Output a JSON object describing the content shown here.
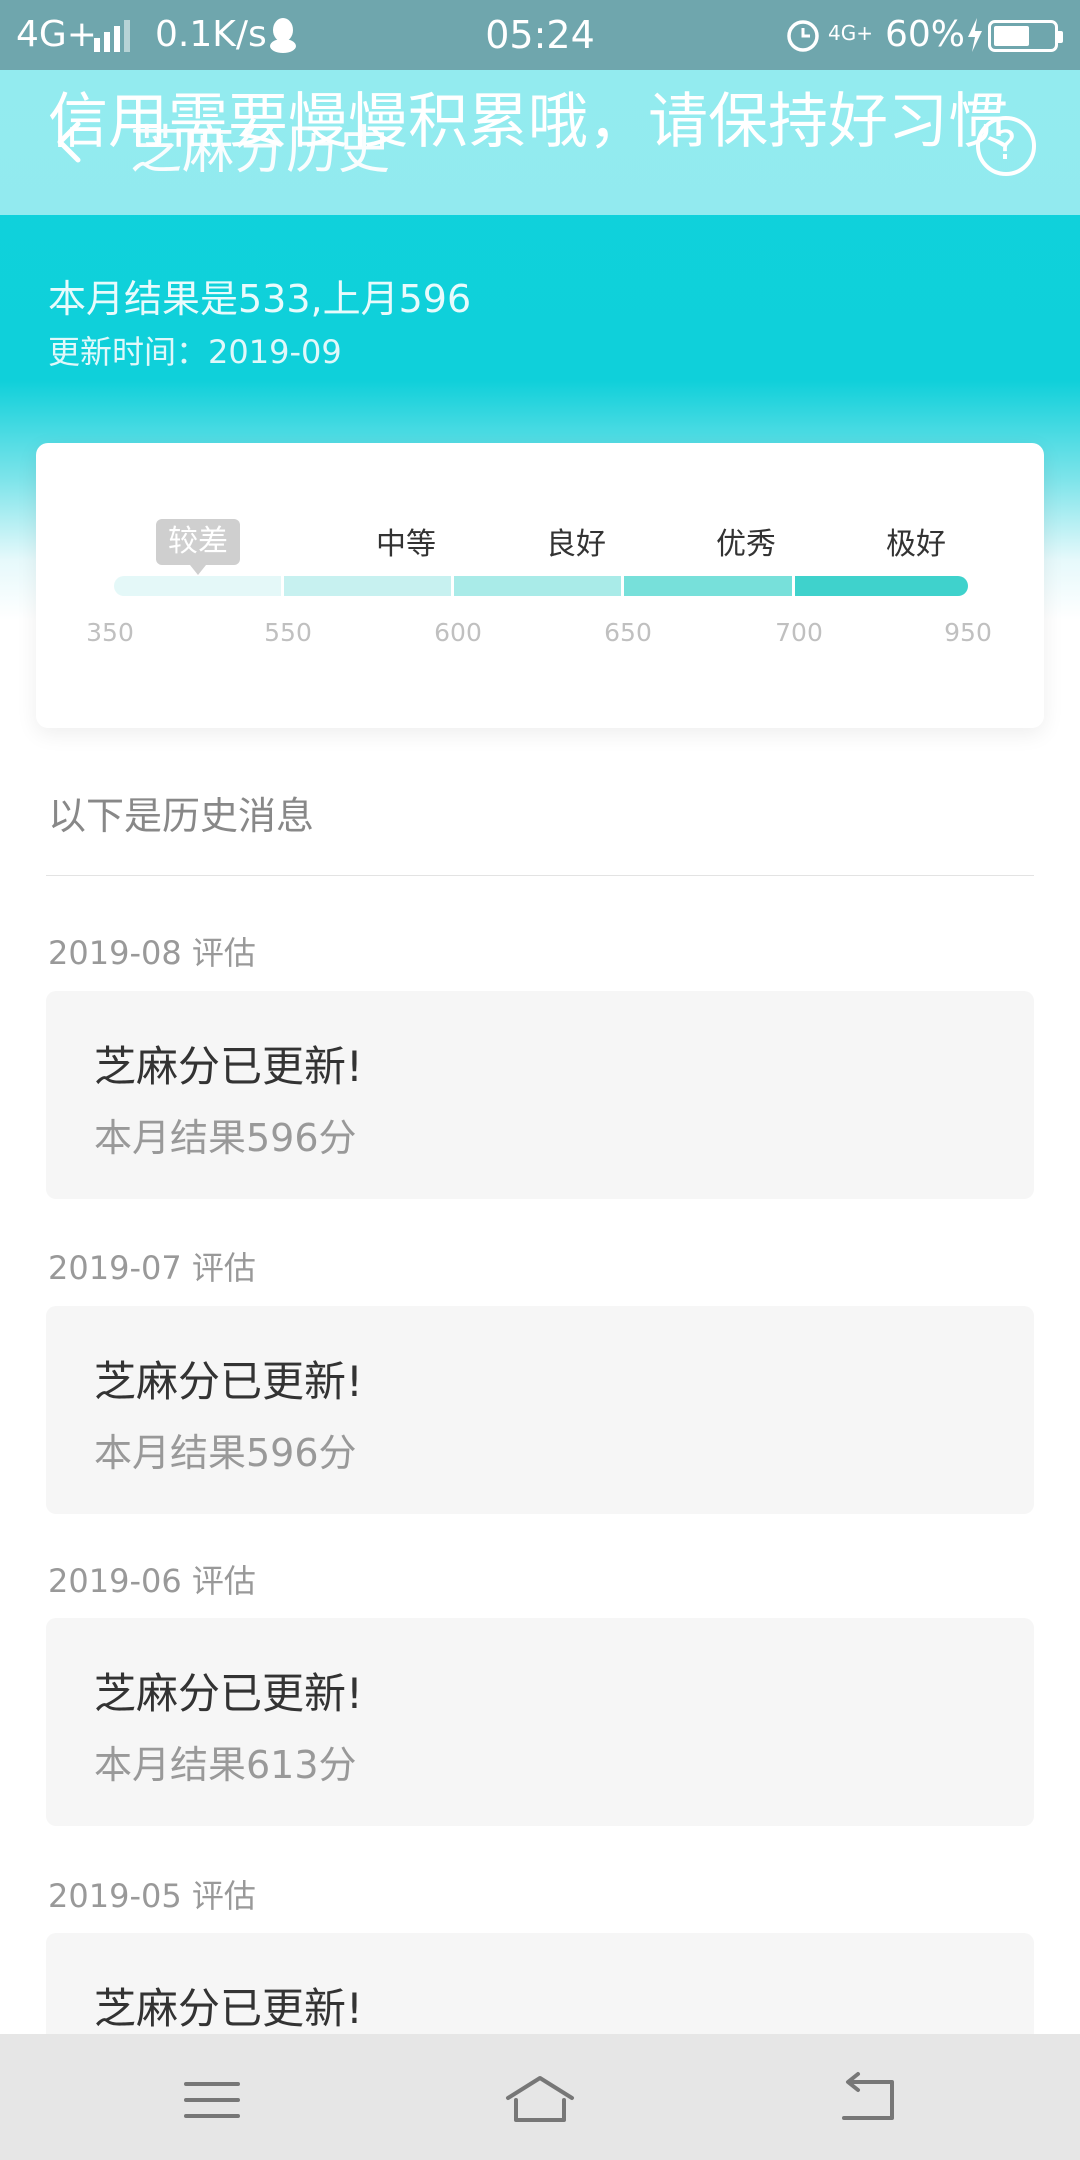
{
  "status_bar": {
    "network": "4G+",
    "speed": "0.1K/s",
    "time": "05:24",
    "signal_label": "4G+",
    "battery": "60%",
    "battery_level": 0.6
  },
  "header": {
    "title": "芝麻分历史",
    "help": "?",
    "slogan": "信用需要慢慢积累哦，请保持好习惯",
    "result": "本月结果是533,上月596",
    "updated": "更新时间：2019-09"
  },
  "level_card": {
    "current_badge": "较差",
    "levels": [
      "中等",
      "良好",
      "优秀",
      "极好"
    ],
    "ticks": [
      "350",
      "550",
      "600",
      "650",
      "700",
      "950"
    ],
    "segment_colors": [
      "#e4f8f8",
      "#c7f1f0",
      "#a9ebe8",
      "#77e0da",
      "#3fd2cc"
    ]
  },
  "history": {
    "heading": "以下是历史消息",
    "entries": [
      {
        "month": "2019-08 评估",
        "title": "芝麻分已更新!",
        "result": "本月结果596分"
      },
      {
        "month": "2019-07 评估",
        "title": "芝麻分已更新!",
        "result": "本月结果596分"
      },
      {
        "month": "2019-06 评估",
        "title": "芝麻分已更新!",
        "result": "本月结果613分"
      },
      {
        "month": "2019-05 评估",
        "title": "芝麻分已更新!",
        "result": ""
      }
    ]
  },
  "nav_bar": {
    "buttons": [
      "menu-icon",
      "home-icon",
      "back-icon"
    ]
  }
}
